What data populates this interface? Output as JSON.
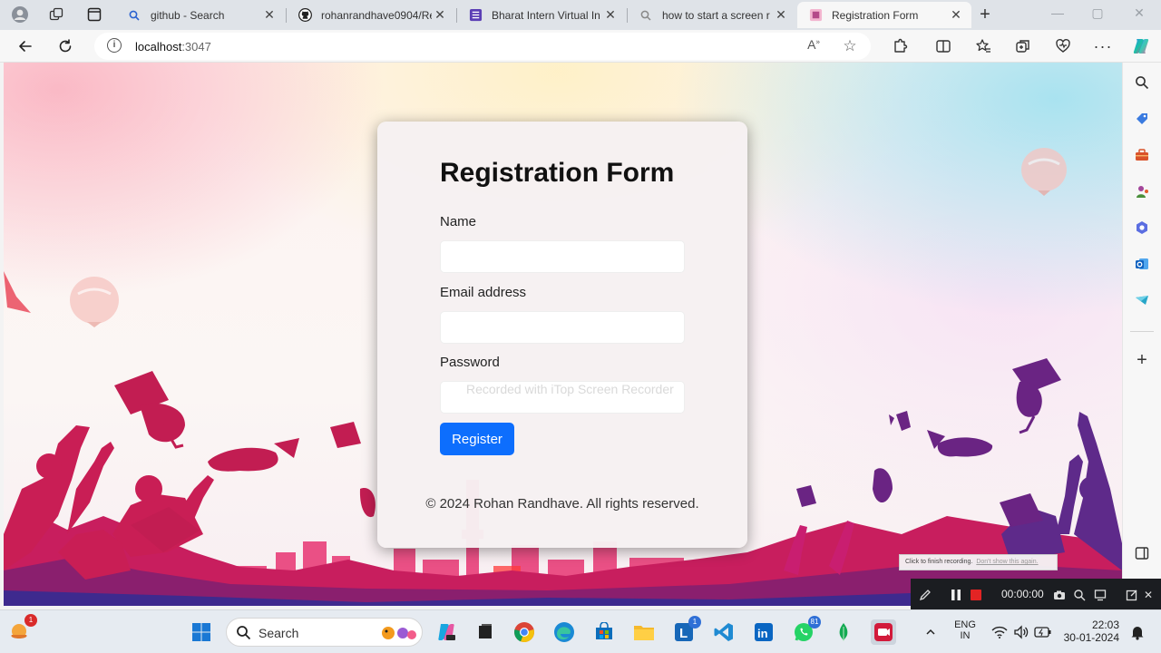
{
  "browser": {
    "tabs": [
      {
        "title": "github - Search",
        "icon": "search-icon"
      },
      {
        "title": "rohanrandhave0904/Re",
        "icon": "github-icon"
      },
      {
        "title": "Bharat Intern Virtual In",
        "icon": "form-icon"
      },
      {
        "title": "how to start a screen r",
        "icon": "search-icon"
      },
      {
        "title": "Registration Form",
        "icon": "page-icon",
        "active": true
      }
    ],
    "url_host": "localhost",
    "url_port": ":3047"
  },
  "form": {
    "title": "Registration Form",
    "name_label": "Name",
    "email_label": "Email address",
    "password_label": "Password",
    "name_value": "",
    "email_value": "",
    "password_value": "",
    "submit_label": "Register",
    "footer": "© 2024 Rohan Randhave. All rights reserved."
  },
  "overlay": {
    "watermark": "Recorded with iTop Screen Recorder"
  },
  "recorder": {
    "hint": "Click to finish recording.",
    "hint_link": "Don't show this again.",
    "time": "00:00:00"
  },
  "taskbar": {
    "search_label": "Search",
    "notification_count": "1",
    "outlook_badge": "1",
    "whatsapp_badge": "81",
    "lang_line1": "ENG",
    "lang_line2": "IN",
    "time": "22:03",
    "date": "30-01-2024"
  },
  "colors": {
    "primary_button": "#0d6efd",
    "magenta": "#b8175c",
    "purple": "#5e2a8a"
  }
}
